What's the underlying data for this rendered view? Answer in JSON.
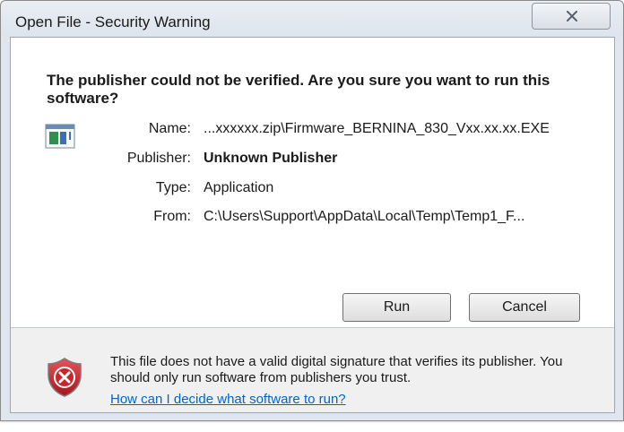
{
  "window": {
    "title": "Open File - Security Warning",
    "close_icon": "close-icon"
  },
  "main": {
    "headline": "The publisher could not be verified.  Are you sure you want to run this software?",
    "file_icon": "application-file-icon",
    "details": [
      {
        "label": "Name:",
        "value": "...xxxxxx.zip\\Firmware_BERNINA_830_Vxx.xx.xx.EXE"
      },
      {
        "label": "Publisher:",
        "value": "Unknown Publisher"
      },
      {
        "label": "Type:",
        "value": "Application"
      },
      {
        "label": "From:",
        "value": "C:\\Users\\Support\\AppData\\Local\\Temp\\Temp1_F..."
      }
    ],
    "buttons": {
      "run_label": "Run",
      "cancel_label": "Cancel"
    }
  },
  "footer": {
    "shield_icon": "security-shield-x-icon",
    "warning_text": "This file does not have a valid digital signature that verifies its publisher.  You should only run software from publishers you trust.",
    "link_text": "How can I decide what software to run?"
  },
  "colors": {
    "link": "#0066cc",
    "shield_red": "#c8262c",
    "window_frame": "#dfe6ee"
  }
}
